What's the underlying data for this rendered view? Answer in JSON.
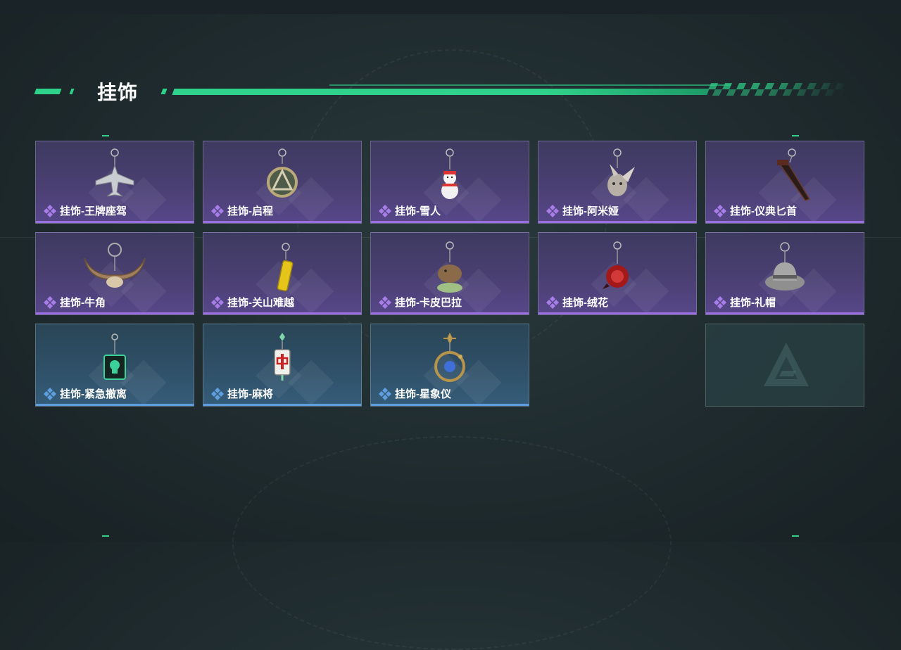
{
  "section": {
    "title": "挂饰"
  },
  "colors": {
    "accent": "#2fd28a",
    "purple_rarity": "#9a6fe0",
    "blue_rarity": "#5f9fe0"
  },
  "items": [
    {
      "label": "挂饰-王牌座驾",
      "rarity": "purple",
      "icon": "jet-plane-charm-icon"
    },
    {
      "label": "挂饰-启程",
      "rarity": "purple",
      "icon": "medallion-charm-icon"
    },
    {
      "label": "挂饰-雪人",
      "rarity": "purple",
      "icon": "snowman-charm-icon"
    },
    {
      "label": "挂饰-阿米娅",
      "rarity": "purple",
      "icon": "bunny-charm-icon"
    },
    {
      "label": "挂饰-仪典匕首",
      "rarity": "purple",
      "icon": "dagger-charm-icon"
    },
    {
      "label": "挂饰-牛角",
      "rarity": "purple",
      "icon": "horns-charm-icon"
    },
    {
      "label": "挂饰-关山难越",
      "rarity": "purple",
      "icon": "yellow-tag-charm-icon"
    },
    {
      "label": "挂饰-卡皮巴拉",
      "rarity": "purple",
      "icon": "capybara-charm-icon"
    },
    {
      "label": "挂饰-绒花",
      "rarity": "purple",
      "icon": "red-flower-charm-icon"
    },
    {
      "label": "挂饰-礼帽",
      "rarity": "purple",
      "icon": "hat-charm-icon"
    },
    {
      "label": "挂饰-紧急撤离",
      "rarity": "blue",
      "icon": "green-skull-charm-icon"
    },
    {
      "label": "挂饰-麻将",
      "rarity": "blue",
      "icon": "mahjong-tile-charm-icon"
    },
    {
      "label": "挂饰-星象仪",
      "rarity": "blue",
      "icon": "astrolabe-charm-icon"
    }
  ],
  "empty_slot": {
    "icon": "game-logo-icon"
  }
}
